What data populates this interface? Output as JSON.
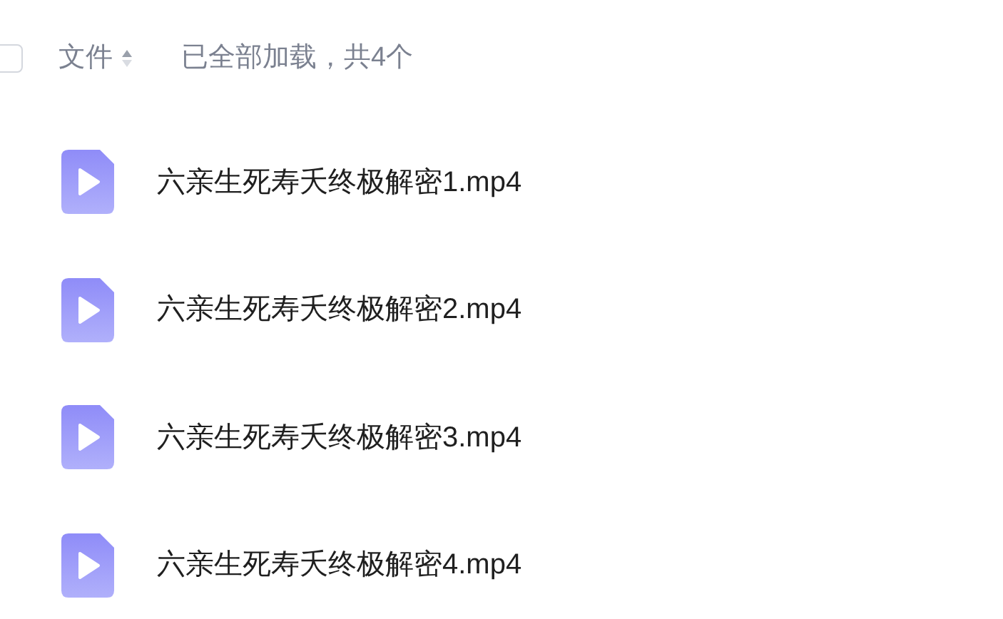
{
  "header": {
    "select_all": {
      "checked": false
    },
    "column": "文件",
    "status": "已全部加载，共4个"
  },
  "files": [
    {
      "name": "六亲生死寿夭终极解密1.mp4"
    },
    {
      "name": "六亲生死寿夭终极解密2.mp4"
    },
    {
      "name": "六亲生死寿夭终极解密3.mp4"
    },
    {
      "name": "六亲生死寿夭终极解密4.mp4"
    }
  ]
}
